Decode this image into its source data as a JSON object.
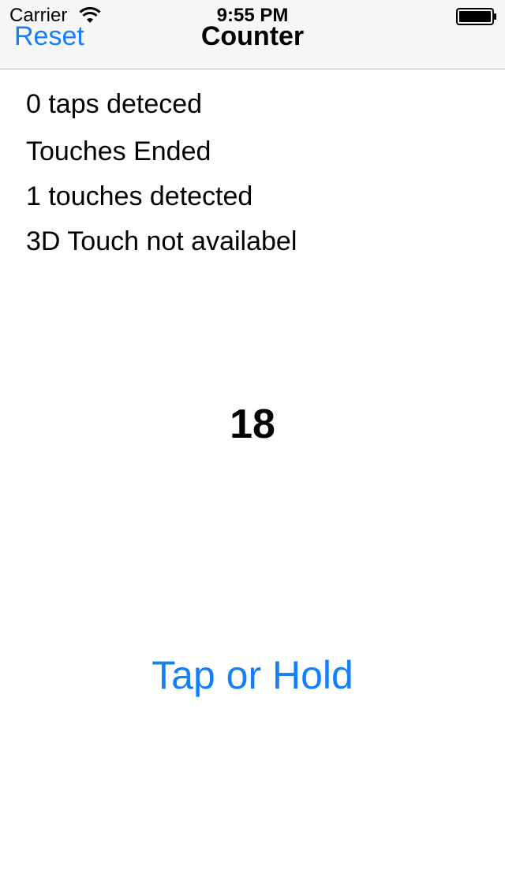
{
  "status_bar": {
    "carrier": "Carrier",
    "time": "9:55 PM",
    "wifi_icon": "wifi-icon",
    "battery_icon": "battery-icon"
  },
  "nav": {
    "reset_label": "Reset",
    "title": "Counter"
  },
  "info": {
    "taps": "0 taps deteced",
    "touch_state": "Touches Ended",
    "touches": "1 touches detected",
    "force_touch": "3D Touch not availabel"
  },
  "counter": {
    "value": "18"
  },
  "action": {
    "tap_label": "Tap or Hold"
  },
  "colors": {
    "accent": "#147efb",
    "nav_background": "#f7f7f7",
    "background": "#ffffff"
  }
}
